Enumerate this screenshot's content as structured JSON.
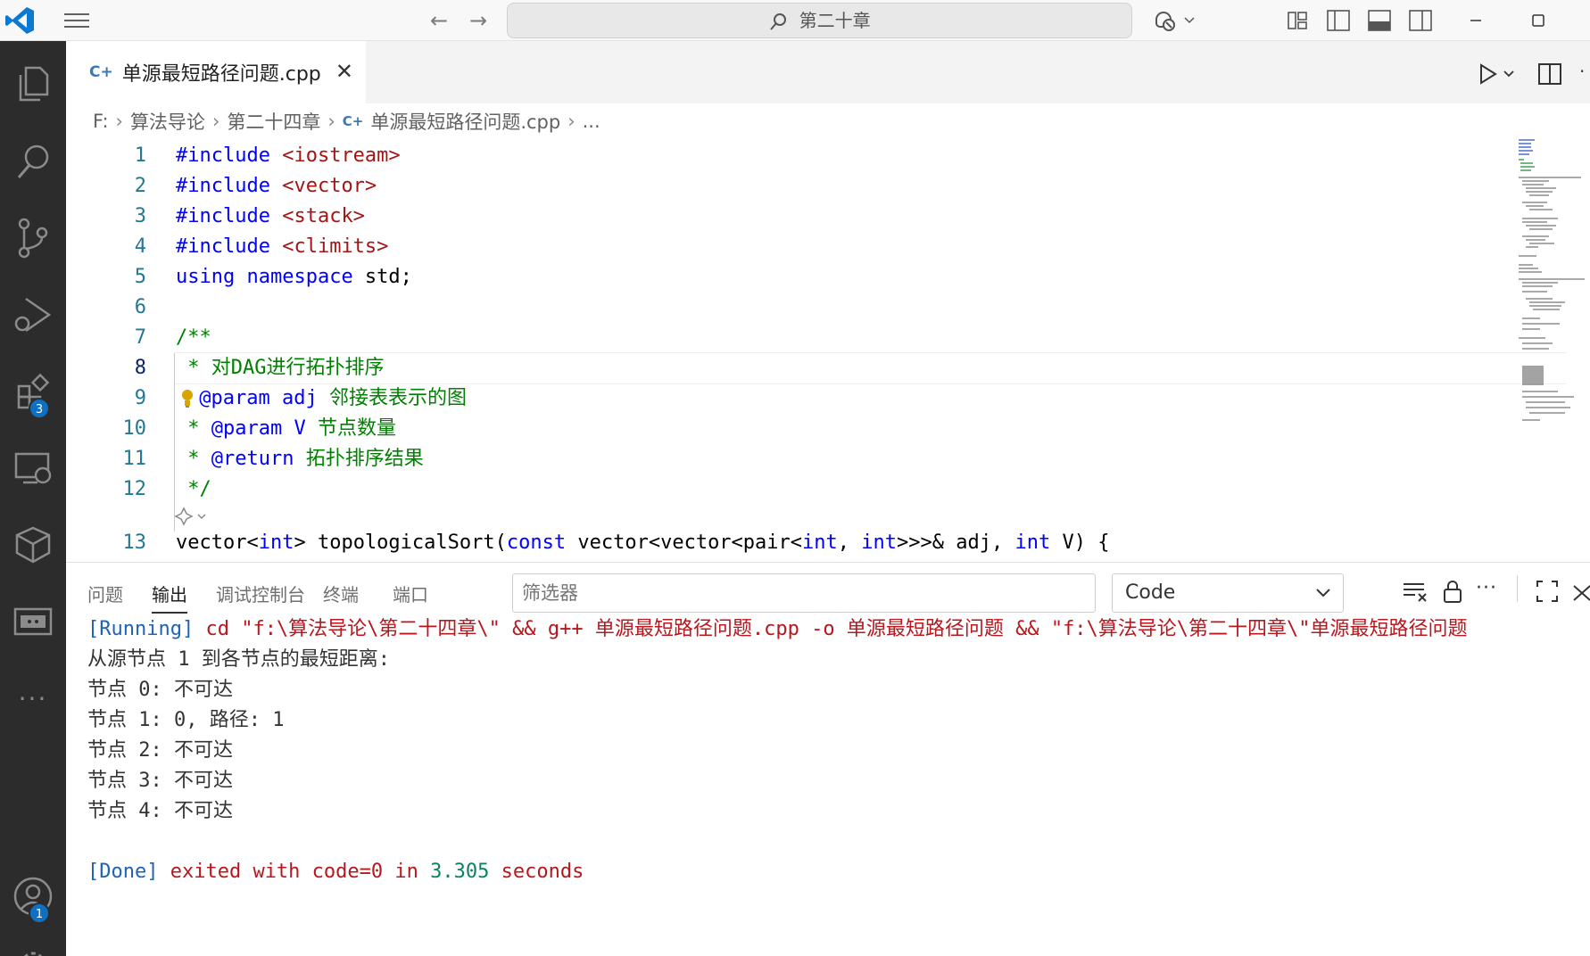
{
  "titlebar": {
    "search_text": "第二十章",
    "back_label": "←",
    "forward_label": "→"
  },
  "activity": {
    "items": [
      {
        "icon": "files-icon"
      },
      {
        "icon": "search-icon"
      },
      {
        "icon": "source-control-icon"
      },
      {
        "icon": "run-debug-icon"
      },
      {
        "icon": "extensions-icon",
        "badge": "3"
      },
      {
        "icon": "remote-explorer-icon"
      },
      {
        "icon": "package-icon"
      },
      {
        "icon": "remote-icon"
      },
      {
        "icon": "more-icon",
        "label": "···"
      },
      {
        "icon": "accounts-icon",
        "badge": "1"
      }
    ]
  },
  "tabs": [
    {
      "label": "单源最短路径问题.cpp",
      "icon_text": "C+",
      "close": "✕"
    }
  ],
  "breadcrumb": {
    "items": [
      "F:",
      "算法导论",
      "第二十四章",
      "单源最短路径问题.cpp",
      "..."
    ],
    "icon_text": "C+",
    "separator": "›"
  },
  "editor": {
    "line_numbers": [
      "1",
      "2",
      "3",
      "4",
      "5",
      "6",
      "7",
      "8",
      "9",
      "10",
      "11",
      "12",
      "13"
    ],
    "active_line": "8",
    "lines": {
      "l1_pre": "#include",
      "l1_str": " <iostream>",
      "l2_pre": "#include",
      "l2_str": " <vector>",
      "l3_pre": "#include",
      "l3_str": " <stack>",
      "l4_pre": "#include",
      "l4_str": " <climits>",
      "l5_kw1": "using",
      "l5_kw2": " namespace",
      "l5_rest": " std;",
      "l7": "/**",
      "l8": " * 对DAG进行拓扑排序",
      "l9_tag": " @param adj",
      "l9_rest": " 邻接表表示的图",
      "l10_star": " *",
      "l10_tag": " @param V",
      "l10_rest": " 节点数量",
      "l11_star": " *",
      "l11_tag": " @return",
      "l11_rest": " 拓扑排序结果",
      "l12": " */",
      "l13_a": "vector<",
      "l13_int1": "int",
      "l13_b": "> topologicalSort(",
      "l13_const": "const",
      "l13_c": " vector<vector<pair<",
      "l13_int2": "int",
      "l13_d": ", ",
      "l13_int3": "int",
      "l13_e": ">>>& adj, ",
      "l13_int4": "int",
      "l13_f": " V) {"
    }
  },
  "panel": {
    "tabs": [
      "问题",
      "输出",
      "调试控制台",
      "终端",
      "端口"
    ],
    "active_tab": "输出",
    "filter_placeholder": "筛选器",
    "select_value": "Code",
    "output": {
      "run_tag": "[Running]",
      "run_cmd": " cd \"f:\\算法导论\\第二十四章\\\" && g++ 单源最短路径问题.cpp -o 单源最短路径问题 && \"f:\\算法导论\\第二十四章\\\"单源最短路径问题",
      "lines": [
        "从源节点 1 到各节点的最短距离:",
        "节点 0: 不可达",
        "节点 1: 0, 路径: 1",
        "节点 2: 不可达",
        "节点 3: 不可达",
        "节点 4: 不可达"
      ],
      "done_tag": "[Done]",
      "done_a": " exited with ",
      "done_code": "code=0",
      "done_b": " in ",
      "done_secs": "3.305",
      "done_c": " seconds"
    }
  },
  "colors": {
    "activity_bg": "#2c2c2c",
    "badge": "#0f6fc2",
    "keyword": "#0000ff",
    "string": "#a31515",
    "comment": "#008000"
  }
}
